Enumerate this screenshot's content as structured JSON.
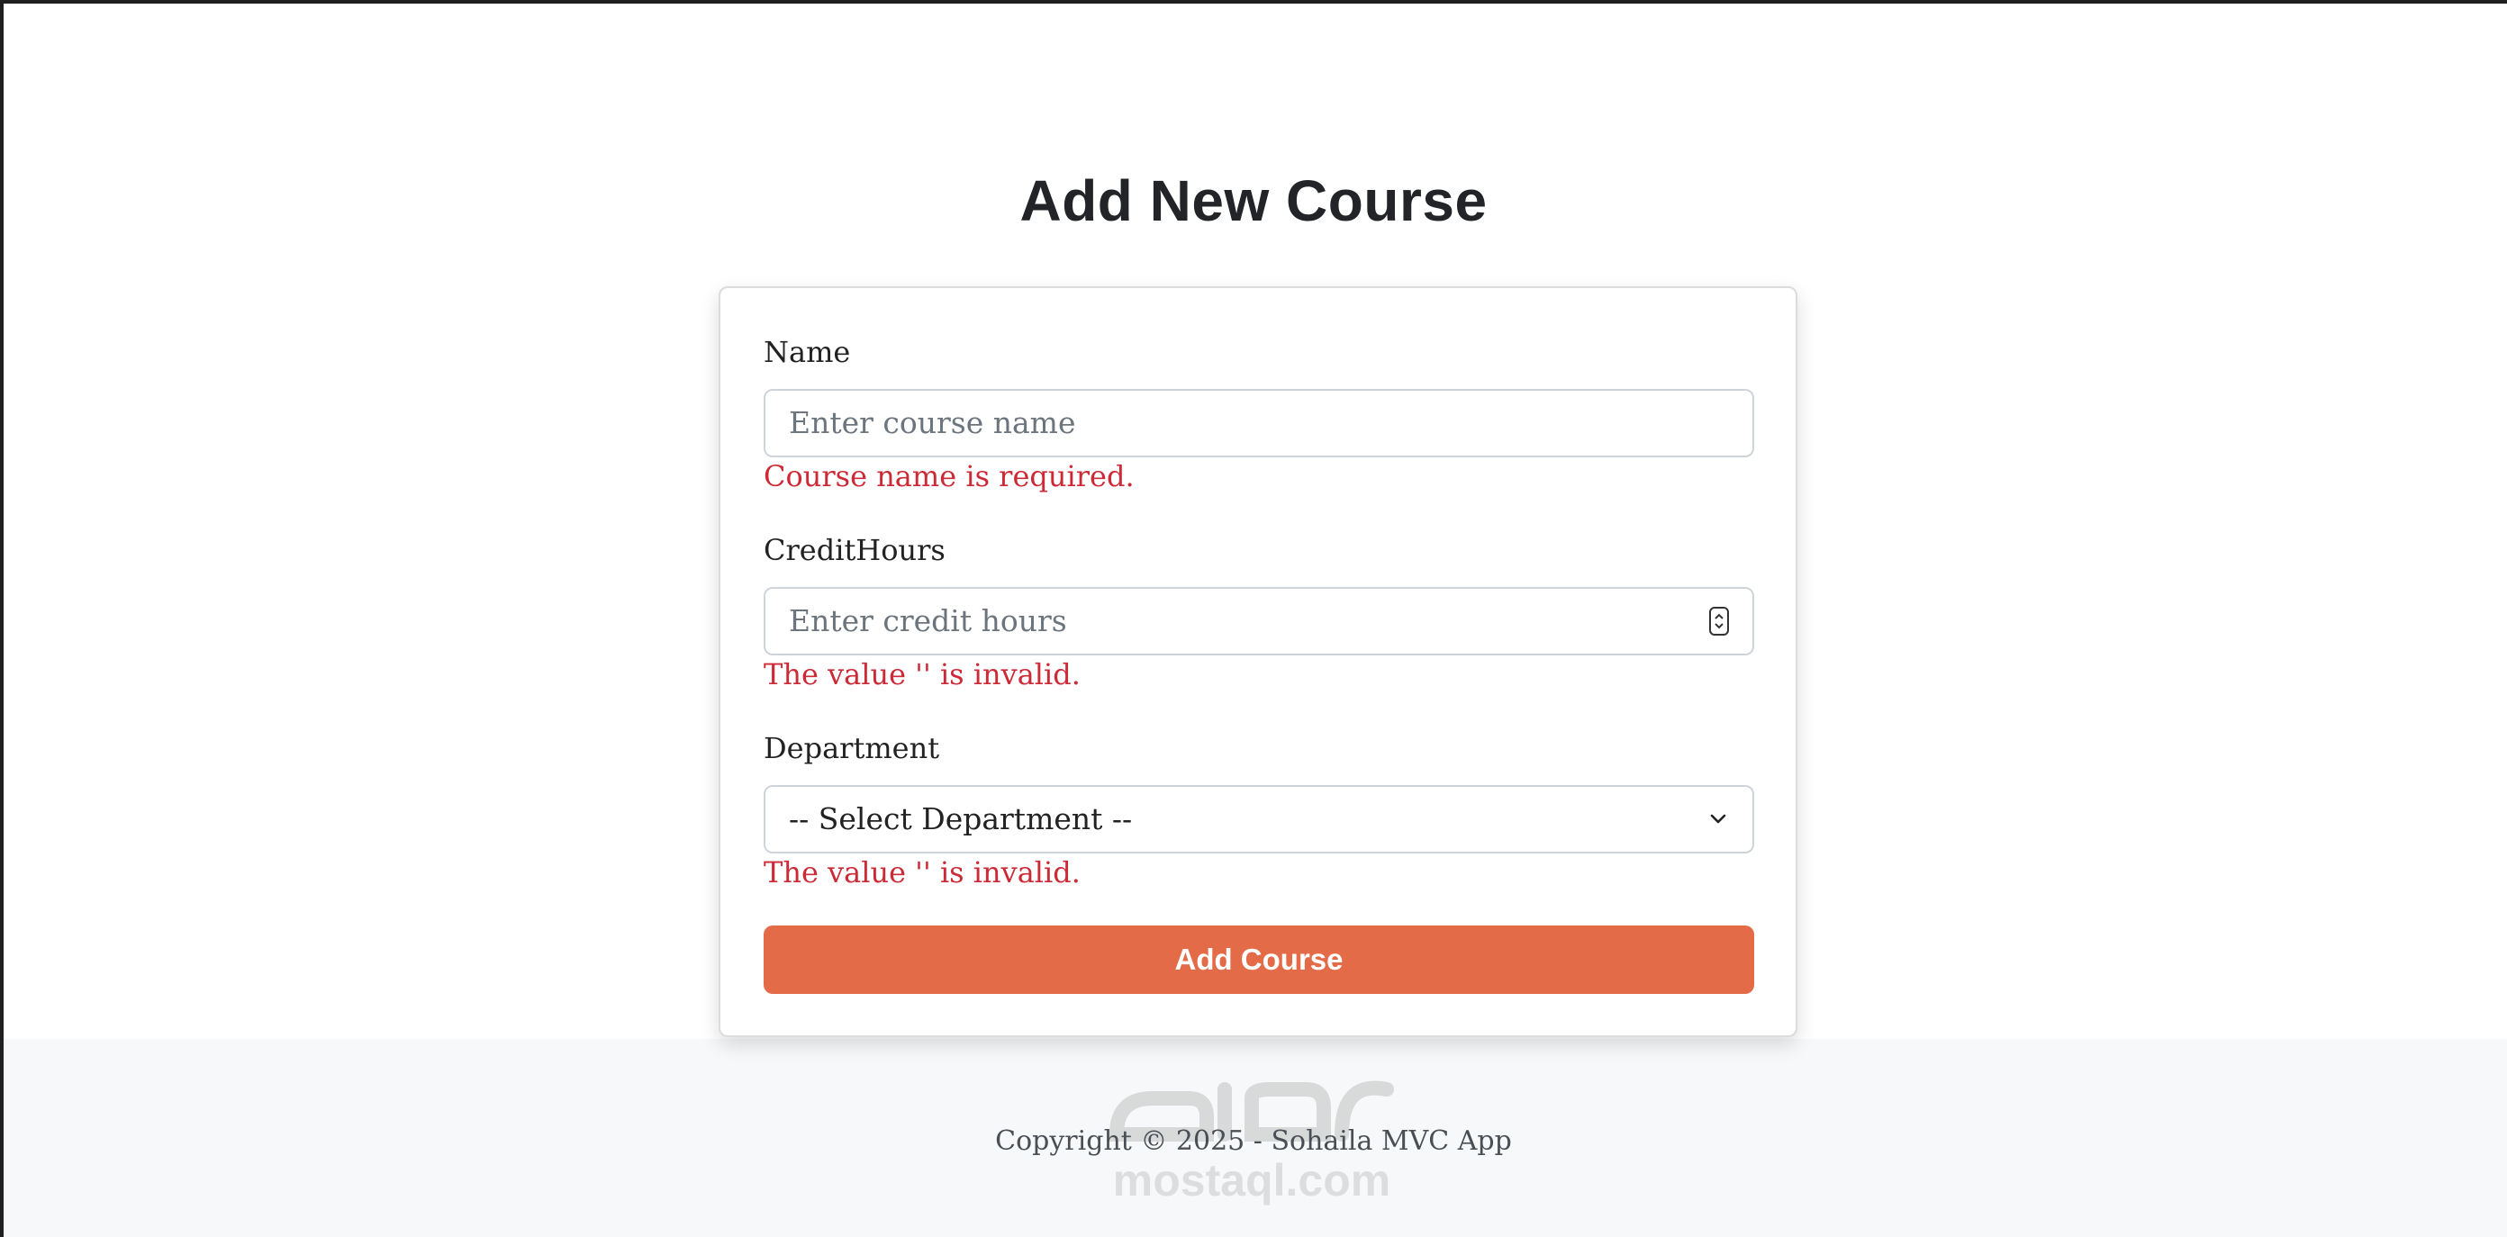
{
  "page": {
    "title": "Add New Course"
  },
  "form": {
    "name": {
      "label": "Name",
      "placeholder": "Enter course name",
      "error": "Course name is required."
    },
    "credit_hours": {
      "label": "CreditHours",
      "placeholder": "Enter credit hours",
      "error": "The value '' is invalid."
    },
    "department": {
      "label": "Department",
      "selected": "-- Select Department --",
      "error": "The value '' is invalid."
    },
    "submit_label": "Add Course"
  },
  "footer": {
    "copyright": "Copyright © 2025 - Sohaila MVC App"
  },
  "watermark": {
    "text": "mostaql.com"
  },
  "colors": {
    "accent": "#e36b47",
    "error": "#cc2a36",
    "footer_bg": "#f7f8f9"
  },
  "icons": {
    "number_spinner": "spinner-icon",
    "select_arrow": "chevron-down-icon"
  }
}
